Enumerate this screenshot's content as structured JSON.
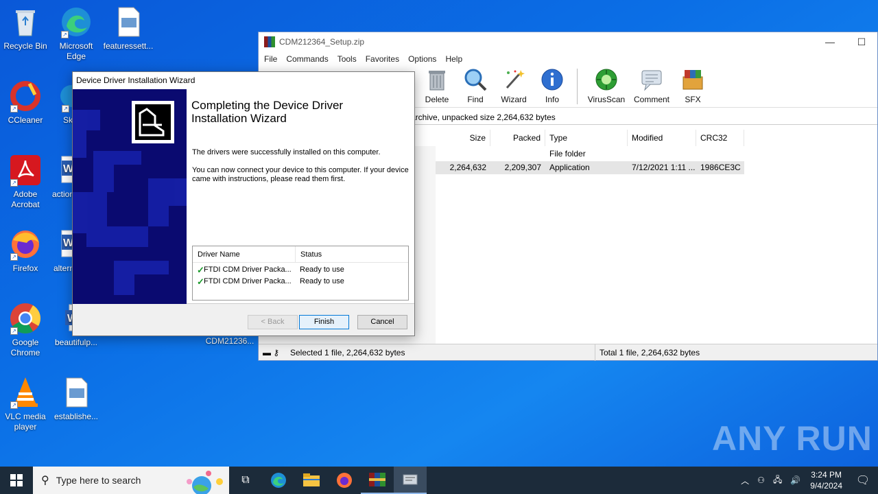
{
  "desktop": {
    "icons": [
      {
        "label": "Recycle Bin"
      },
      {
        "label": "Microsoft Edge"
      },
      {
        "label": "featuressett..."
      },
      {
        "label": "CCleaner"
      },
      {
        "label": "Sk"
      },
      {
        "label": "Adobe Acrobat"
      },
      {
        "label": "action"
      },
      {
        "label": "Firefox"
      },
      {
        "label": "altern"
      },
      {
        "label": "Google Chrome"
      },
      {
        "label": "beautifulp..."
      },
      {
        "label": "CDM21236..."
      },
      {
        "label": "VLC media player"
      },
      {
        "label": "establishe..."
      }
    ]
  },
  "winrar": {
    "title": "CDM212364_Setup.zip",
    "menu": [
      "File",
      "Commands",
      "Tools",
      "Favorites",
      "Options",
      "Help"
    ],
    "toolbar": [
      "Delete",
      "Find",
      "Wizard",
      "Info",
      "VirusScan",
      "Comment",
      "SFX"
    ],
    "address": "archive, unpacked size 2,264,632 bytes",
    "columns": [
      "Size",
      "Packed",
      "Type",
      "Modified",
      "CRC32"
    ],
    "rows": [
      {
        "size": "",
        "packed": "",
        "type": "File folder",
        "modified": "",
        "crc": ""
      },
      {
        "size": "2,264,632",
        "packed": "2,209,307",
        "type": "Application",
        "modified": "7/12/2021 1:11 ...",
        "crc": "1986CE3C"
      }
    ],
    "status_left": "Selected 1 file, 2,264,632 bytes",
    "status_right": "Total 1 file, 2,264,632 bytes"
  },
  "wizard": {
    "title": "Device Driver Installation Wizard",
    "heading": "Completing the Device Driver Installation Wizard",
    "line1": "The drivers were successfully installed on this computer.",
    "line2": "You can now connect your device to this computer. If your device came with instructions, please read them first.",
    "table_headers": [
      "Driver Name",
      "Status"
    ],
    "drivers": [
      {
        "name": "FTDI CDM Driver Packa...",
        "status": "Ready to use"
      },
      {
        "name": "FTDI CDM Driver Packa...",
        "status": "Ready to use"
      }
    ],
    "back_label": "< Back",
    "finish_label": "Finish",
    "cancel_label": "Cancel"
  },
  "taskbar": {
    "search_placeholder": "Type here to search",
    "time": "3:24 PM",
    "date": "9/4/2024"
  },
  "watermark": "ANY RUN"
}
